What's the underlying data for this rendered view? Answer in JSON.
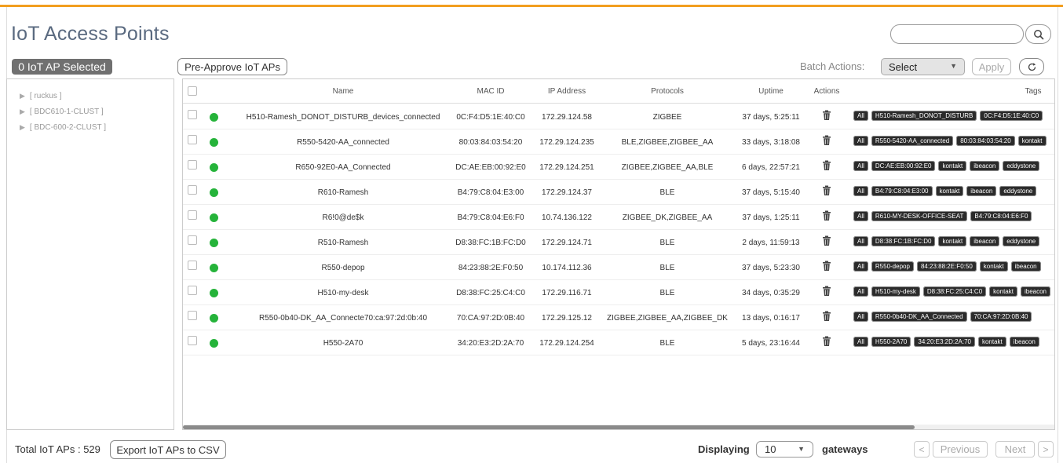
{
  "page": {
    "title": "IoT Access Points",
    "selected_badge": "0 IoT AP Selected",
    "pre_approve_label": "Pre-Approve IoT APs",
    "batch_actions_label": "Batch Actions:",
    "batch_select_value": "Select",
    "apply_label": "Apply",
    "search_placeholder": ""
  },
  "tree": {
    "items": [
      {
        "label": "[ ruckus ]"
      },
      {
        "label": "[ BDC610-1-CLUST ]"
      },
      {
        "label": "[ BDC-600-2-CLUST ]"
      }
    ]
  },
  "table": {
    "columns": {
      "name": "Name",
      "mac": "MAC ID",
      "ip": "IP Address",
      "protocols": "Protocols",
      "uptime": "Uptime",
      "actions": "Actions",
      "tags": "Tags"
    },
    "rows": [
      {
        "status": "online",
        "name": "H510-Ramesh_DONOT_DISTURB_devices_connected",
        "mac": "0C:F4:D5:1E:40:C0",
        "ip": "172.29.124.58",
        "protocols": "ZIGBEE",
        "uptime": "37 days, 5:25:11",
        "tags": [
          "All",
          "H510-Ramesh_DONOT_DISTURB",
          "0C:F4:D5:1E:40:C0"
        ]
      },
      {
        "status": "online",
        "name": "R550-5420-AA_connected",
        "mac": "80:03:84:03:54:20",
        "ip": "172.29.124.235",
        "protocols": "BLE,ZIGBEE,ZIGBEE_AA",
        "uptime": "33 days, 3:18:08",
        "tags": [
          "All",
          "R550-5420-AA_connected",
          "80:03:84:03:54:20",
          "kontakt"
        ]
      },
      {
        "status": "online",
        "name": "R650-92E0-AA_Connected",
        "mac": "DC:AE:EB:00:92:E0",
        "ip": "172.29.124.251",
        "protocols": "ZIGBEE,ZIGBEE_AA,BLE",
        "uptime": "6 days, 22:57:21",
        "tags": [
          "All",
          "DC:AE:EB:00:92:E0",
          "kontakt",
          "ibeacon",
          "eddystone"
        ]
      },
      {
        "status": "online",
        "name": "R610-Ramesh",
        "mac": "B4:79:C8:04:E3:00",
        "ip": "172.29.124.37",
        "protocols": "BLE",
        "uptime": "37 days, 5:15:40",
        "tags": [
          "All",
          "B4:79:C8:04:E3:00",
          "kontakt",
          "ibeacon",
          "eddystone"
        ]
      },
      {
        "status": "online",
        "name": "R6!0@de$k",
        "mac": "B4:79:C8:04:E6:F0",
        "ip": "10.74.136.122",
        "protocols": "ZIGBEE_DK,ZIGBEE_AA",
        "uptime": "37 days, 1:25:11",
        "tags": [
          "All",
          "R610-MY-DESK-OFFICE-SEAT",
          "B4:79:C8:04:E6:F0"
        ]
      },
      {
        "status": "online",
        "name": "R510-Ramesh",
        "mac": "D8:38:FC:1B:FC:D0",
        "ip": "172.29.124.71",
        "protocols": "BLE",
        "uptime": "2 days, 11:59:13",
        "tags": [
          "All",
          "D8:38:FC:1B:FC:D0",
          "kontakt",
          "ibeacon",
          "eddystone"
        ]
      },
      {
        "status": "online",
        "name": "R550-depop",
        "mac": "84:23:88:2E:F0:50",
        "ip": "10.174.112.36",
        "protocols": "BLE",
        "uptime": "37 days, 5:23:30",
        "tags": [
          "All",
          "R550-depop",
          "84:23:88:2E:F0:50",
          "kontakt",
          "ibeacon"
        ]
      },
      {
        "status": "online",
        "name": "H510-my-desk",
        "mac": "D8:38:FC:25:C4:C0",
        "ip": "172.29.116.71",
        "protocols": "BLE",
        "uptime": "34 days, 0:35:29",
        "tags": [
          "All",
          "H510-my-desk",
          "D8:38:FC:25:C4:C0",
          "kontakt",
          "ibeacon"
        ]
      },
      {
        "status": "online",
        "name": "R550-0b40-DK_AA_Connecte70:ca:97:2d:0b:40",
        "mac": "70:CA:97:2D:0B:40",
        "ip": "172.29.125.12",
        "protocols": "ZIGBEE,ZIGBEE_AA,ZIGBEE_DK",
        "uptime": "13 days, 0:16:17",
        "tags": [
          "All",
          "R550-0b40-DK_AA_Connected",
          "70:CA:97:2D:0B:40"
        ]
      },
      {
        "status": "online",
        "name": "H550-2A70",
        "mac": "34:20:E3:2D:2A:70",
        "ip": "172.29.124.254",
        "protocols": "BLE",
        "uptime": "5 days, 23:16:44",
        "tags": [
          "All",
          "H550-2A70",
          "34:20:E3:2D:2A:70",
          "kontakt",
          "ibeacon"
        ]
      }
    ]
  },
  "footer": {
    "total_label": "Total IoT APs : 529",
    "export_label": "Export IoT APs to CSV",
    "displaying_label": "Displaying",
    "page_size": "10",
    "gateways_label": "gateways",
    "prev_arrow": "<",
    "previous_label": "Previous",
    "next_label": "Next",
    "next_arrow": ">"
  },
  "colors": {
    "accent_top": "#f29e1f",
    "status_online": "#25b33a",
    "tag_bg": "#2b2b2b"
  },
  "icons": {
    "search": "search-icon",
    "refresh": "refresh-icon",
    "trash": "trash-icon",
    "tree_arrow": "caret-right-icon",
    "dropdown": "chevron-down-icon"
  }
}
